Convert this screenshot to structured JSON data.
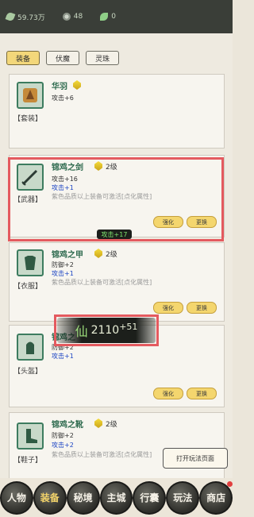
{
  "topbar": {
    "jade": "59.73万",
    "gear": "48",
    "leaf": "0"
  },
  "tabs": [
    "装备",
    "伏魔",
    "灵珠"
  ],
  "cards": [
    {
      "name": "华羽",
      "level": "",
      "category": "【套装】",
      "stats": [
        "攻击+6"
      ],
      "blue": [],
      "note": "",
      "buttons": []
    },
    {
      "name": "锦鸡之剑",
      "level": "2级",
      "category": "【武器】",
      "stats": [
        "攻击+16"
      ],
      "blue": [
        "攻击+1"
      ],
      "note": "紫色品质以上装备可激活[点化属性]",
      "buttons": [
        "强化",
        "更换"
      ]
    },
    {
      "name": "锦鸡之甲",
      "level": "2级",
      "category": "【衣服】",
      "stats": [
        "防御+2"
      ],
      "blue": [
        "攻击+1"
      ],
      "note": "紫色品质以上装备可激活[点化属性]",
      "buttons": [
        "强化",
        "更换"
      ]
    },
    {
      "name": "锦鸡之",
      "level": "",
      "category": "【头盔】",
      "stats": [
        "防御+2"
      ],
      "blue": [
        "攻击+1"
      ],
      "note": "",
      "buttons": [
        "强化",
        "更换"
      ]
    },
    {
      "name": "锦鸡之靴",
      "level": "2级",
      "category": "【鞋子】",
      "stats": [
        "防御+2"
      ],
      "blue": [
        "攻击+2"
      ],
      "note": "紫色品质以上装备可激活[点化属性]",
      "buttons": []
    }
  ],
  "popup_attack": "攻击+17",
  "popup_power": {
    "glyph": "仙",
    "value": "2110",
    "delta": "+51"
  },
  "tip": "打开玩法页面",
  "nav": [
    {
      "label": "人物"
    },
    {
      "label": "装备"
    },
    {
      "label": "秘境"
    },
    {
      "label": "主城"
    },
    {
      "label": "行囊"
    },
    {
      "label": "玩法"
    },
    {
      "label": "商店"
    }
  ]
}
